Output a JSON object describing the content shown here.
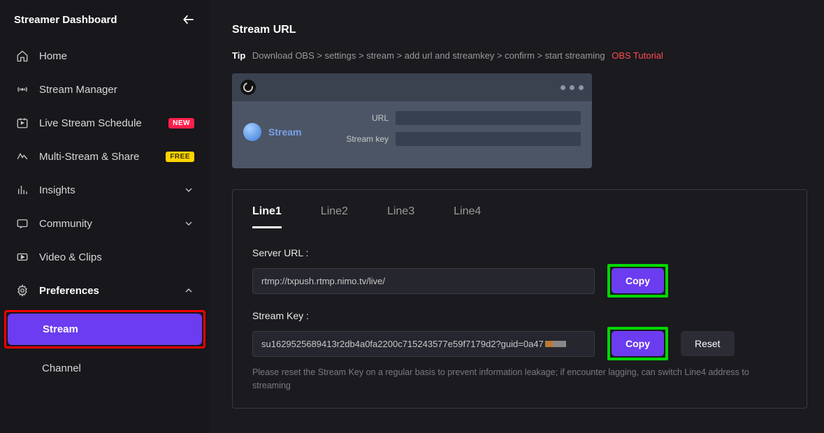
{
  "sidebar": {
    "title": "Streamer Dashboard",
    "items": [
      {
        "label": "Home"
      },
      {
        "label": "Stream Manager"
      },
      {
        "label": "Live Stream Schedule",
        "badge": "NEW"
      },
      {
        "label": "Multi-Stream & Share",
        "badge": "FREE"
      },
      {
        "label": "Insights"
      },
      {
        "label": "Community"
      },
      {
        "label": "Video & Clips"
      },
      {
        "label": "Preferences"
      }
    ],
    "subitems": [
      {
        "label": "Stream"
      },
      {
        "label": "Channel"
      }
    ]
  },
  "main": {
    "title": "Stream URL",
    "tip_word": "Tip",
    "tip_text": "Download OBS > settings > stream > add url and streamkey > confirm > start streaming",
    "tip_link": "OBS Tutorial",
    "obs": {
      "stream_label": "Stream",
      "url_label": "URL",
      "key_label": "Stream key"
    },
    "tabs": [
      "Line1",
      "Line2",
      "Line3",
      "Line4"
    ],
    "server_url_label": "Server URL :",
    "server_url_value": "rtmp://txpush.rtmp.nimo.tv/live/",
    "stream_key_label": "Stream Key :",
    "stream_key_value": "su1629525689413r2db4a0fa2200c715243577e59f7179d2?guid=0a47",
    "copy_label": "Copy",
    "reset_label": "Reset",
    "help_text": "Please reset the Stream Key on a regular basis to prevent information leakage; if encounter lagging, can switch Line4 address to streaming"
  }
}
